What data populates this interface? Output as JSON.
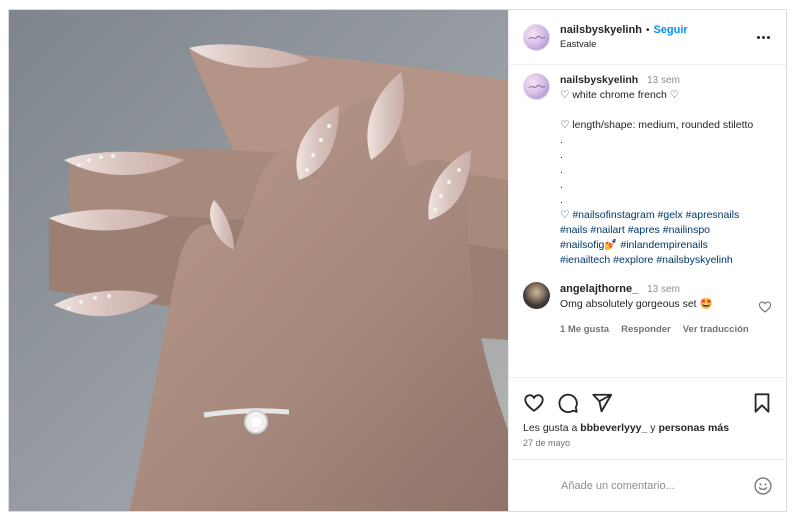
{
  "post": {
    "username": "nailsbyskyelinh",
    "separator": "•",
    "follow_label": "Seguir",
    "location": "Eastvale",
    "more_icon": "more-horizontal-icon",
    "photo_alt": "nails photo"
  },
  "caption": {
    "username": "nailsbyskyelinh",
    "time": "13 sem",
    "line1": "♡ white chrome french ♡",
    "line2": "♡ length/shape: medium, rounded stiletto",
    "dots": [
      ".",
      ".",
      ".",
      ".",
      "."
    ],
    "hashtag_lines": [
      "♡ #nailsofinstagram #gelx #apresnails",
      "#nails #nailart #apres #nailinspo",
      "#nailsofig💅 #inlandempirenails",
      "#ienailtech #explore #nailsbyskyelinh"
    ]
  },
  "comment": {
    "username": "angelajthorne_",
    "time": "13 sem",
    "text": "Omg absolutely gorgeous set 🤩",
    "likes": "1 Me gusta",
    "reply": "Responder",
    "translate": "Ver traducción"
  },
  "actions": {
    "likes_prefix": "Les gusta a ",
    "liked_by": "bbbeverlyyy_",
    "likes_mid": " y ",
    "others": "personas más",
    "date": "27 de mayo",
    "comment_placeholder": "Añade un comentario..."
  },
  "colors": {
    "link_blue": "#0095f6",
    "hashtag_blue": "#00376b",
    "muted": "#737373",
    "text": "#262626"
  }
}
